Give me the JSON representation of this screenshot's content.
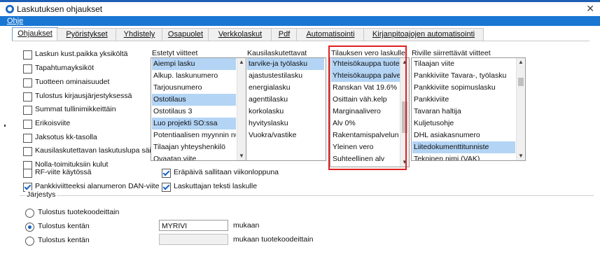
{
  "window": {
    "title": "Laskutuksen ohjaukset",
    "icon_name": "app-logo-icon",
    "close_glyph": "✕"
  },
  "menu": {
    "help": "Ohje"
  },
  "tabs": [
    {
      "label": "Ohjaukset",
      "active": true
    },
    {
      "label": "Pyöristykset"
    },
    {
      "label": "Yhdistely"
    },
    {
      "label": "Osapuolet"
    },
    {
      "label": "Verkkolaskut"
    },
    {
      "label": "Pdf"
    },
    {
      "label": "Automatisointi"
    },
    {
      "label": "Kirjanpitoajojen automatisointi"
    }
  ],
  "checkboxes": [
    {
      "label": "Laskun kust.paikka yksiköltä",
      "checked": false
    },
    {
      "label": "Tapahtumayksiköt",
      "checked": false
    },
    {
      "label": "Tuotteen ominaisuudet",
      "checked": false
    },
    {
      "label": "Tulostus kirjausjärjestyksessä",
      "checked": false
    },
    {
      "label": "Summat tullinimikkeittäin",
      "checked": false
    },
    {
      "label": "Erikoisviite",
      "checked": false
    },
    {
      "label": "Jaksotus kk-tasolla",
      "checked": false
    },
    {
      "label": "Kausilaskutettavan laskutuslupa säilyy",
      "checked": false
    },
    {
      "label": "Nolla-toimituksiin kulut",
      "checked": false
    },
    {
      "label": "RF-viite käytössä",
      "checked": false
    },
    {
      "label": "Pankkiviitteeksi alanumeron DAN-viite",
      "checked": true
    },
    {
      "label": "Eräpäivä sallitaan viikonloppuna",
      "checked": true
    },
    {
      "label": "Laskuttajan teksti laskulle",
      "checked": true
    }
  ],
  "lists": {
    "estetyt": {
      "header": "Estetyt viitteet",
      "items": [
        {
          "text": "Aiempi lasku",
          "sel": true
        },
        {
          "text": "Alkup. laskunumero",
          "sel": false
        },
        {
          "text": "Tarjousnumero",
          "sel": false
        },
        {
          "text": "Ostotilaus",
          "sel": true
        },
        {
          "text": "Ostotilaus 3",
          "sel": false
        },
        {
          "text": "Luo projekti SO:ssa",
          "sel": true
        },
        {
          "text": "Potentiaalisen myynnin nui",
          "sel": false
        },
        {
          "text": "Tilaajan yhteyshenkilö",
          "sel": false
        },
        {
          "text": "Ovaatan viite",
          "sel": false
        }
      ]
    },
    "kausi": {
      "header": "Kausilaskutettavat",
      "items": [
        {
          "text": "tarvike-ja työlasku",
          "sel": true
        },
        {
          "text": "ajastustestilasku",
          "sel": false
        },
        {
          "text": "energialasku",
          "sel": false
        },
        {
          "text": "agenttilasku",
          "sel": false
        },
        {
          "text": "korkolasku",
          "sel": false
        },
        {
          "text": "hyvityslasku",
          "sel": false
        },
        {
          "text": "Vuokra/vastike",
          "sel": false
        }
      ]
    },
    "tilauksen": {
      "header": "Tilauksen vero laskulle",
      "items": [
        {
          "text": "Yhteisökauppa tuote",
          "sel": true
        },
        {
          "text": "Yhteisökauppa palvelu",
          "sel": true
        },
        {
          "text": "Ranskan Vat 19.6%",
          "sel": false
        },
        {
          "text": "Osittain väh.kelp",
          "sel": false
        },
        {
          "text": "Marginaalivero",
          "sel": false
        },
        {
          "text": "Alv 0%",
          "sel": false
        },
        {
          "text": "Rakentamispalvelun al",
          "sel": false
        },
        {
          "text": "Yleinen vero",
          "sel": false
        },
        {
          "text": "Suhteellinen alv",
          "sel": false
        }
      ]
    },
    "riville": {
      "header": "Riville siirrettävät viitteet",
      "items": [
        {
          "text": "Tilaajan viite",
          "sel": false
        },
        {
          "text": "Pankkiviite Tavara-, työlasku",
          "sel": false
        },
        {
          "text": "Pankkiviite sopimuslasku",
          "sel": false
        },
        {
          "text": "Pankkiviite",
          "sel": false
        },
        {
          "text": "Tavaran haltija",
          "sel": false
        },
        {
          "text": "Kuljetusohje",
          "sel": false
        },
        {
          "text": "DHL asiakasnumero",
          "sel": false
        },
        {
          "text": "Liitedokumenttitunniste",
          "sel": true
        },
        {
          "text": "Tekninen nimi (VAK)",
          "sel": false
        }
      ]
    }
  },
  "jarjestys": {
    "title": "Järjestys",
    "options": [
      {
        "label": "Tulostus tuotekoodeittain",
        "on": false
      },
      {
        "label": "Tulostus kentän",
        "on": true,
        "value": "MYRIVI",
        "suffix": "mukaan"
      },
      {
        "label": "Tulostus kentän",
        "on": false,
        "value": "",
        "suffix": "mukaan tuotekoodeittain"
      }
    ]
  },
  "colors": {
    "accent": "#1976d2",
    "selection": "#b3d4f5",
    "highlight_box": "#e02020"
  }
}
